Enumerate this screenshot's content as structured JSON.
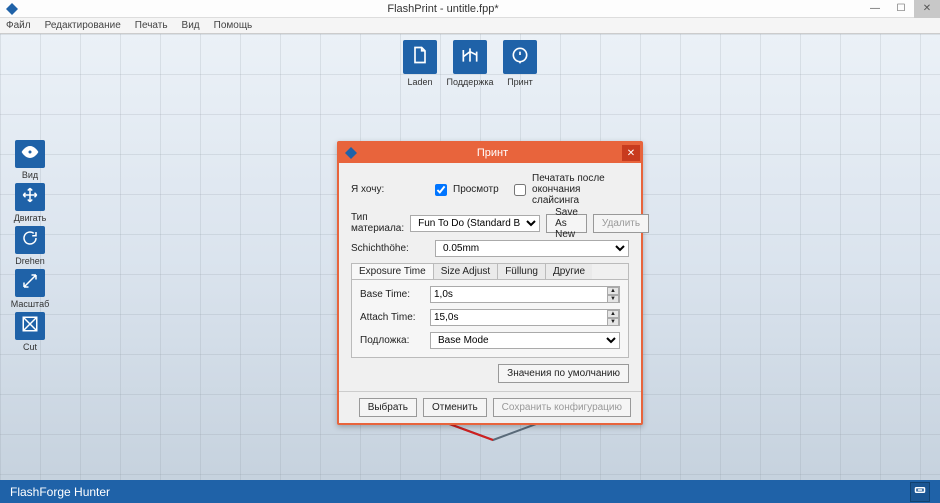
{
  "window": {
    "title": "FlashPrint - untitle.fpp*"
  },
  "menu": {
    "items": [
      "Файл",
      "Редактирование",
      "Печать",
      "Вид",
      "Помощь"
    ]
  },
  "top_toolbar": {
    "laden": "Laden",
    "support": "Поддержка",
    "print": "Принт"
  },
  "left_toolbar": {
    "view": "Вид",
    "move": "Двигать",
    "rotate": "Drehen",
    "scale": "Масштаб",
    "cut": "Cut"
  },
  "dialog": {
    "title": "Принт",
    "labels": {
      "i_want": "Я хочу:",
      "preview": "Просмотр",
      "print_after": "Печатать после окончания слайсинга",
      "material_type": "Тип материала:",
      "save_as_new": "Save As New",
      "delete": "Удалить",
      "layer_height": "Schichthöhe:",
      "defaults": "Значения по умолчанию",
      "select": "Выбрать",
      "cancel": "Отменить",
      "save_config": "Сохранить конфигурацию"
    },
    "values": {
      "preview_checked": true,
      "print_after_checked": false,
      "material": "Fun To Do (Standard Blend)",
      "layer_height": "0.05mm",
      "base_time": "1,0s",
      "attach_time": "15,0s",
      "base_mode": "Base Mode"
    },
    "tabs": [
      "Exposure Time",
      "Size Adjust",
      "Füllung",
      "Другие"
    ],
    "tab_labels": {
      "base_time": "Base Time:",
      "attach_time": "Attach Time:",
      "podlozhka": "Подложка:"
    }
  },
  "statusbar": {
    "device": "FlashForge Hunter"
  }
}
